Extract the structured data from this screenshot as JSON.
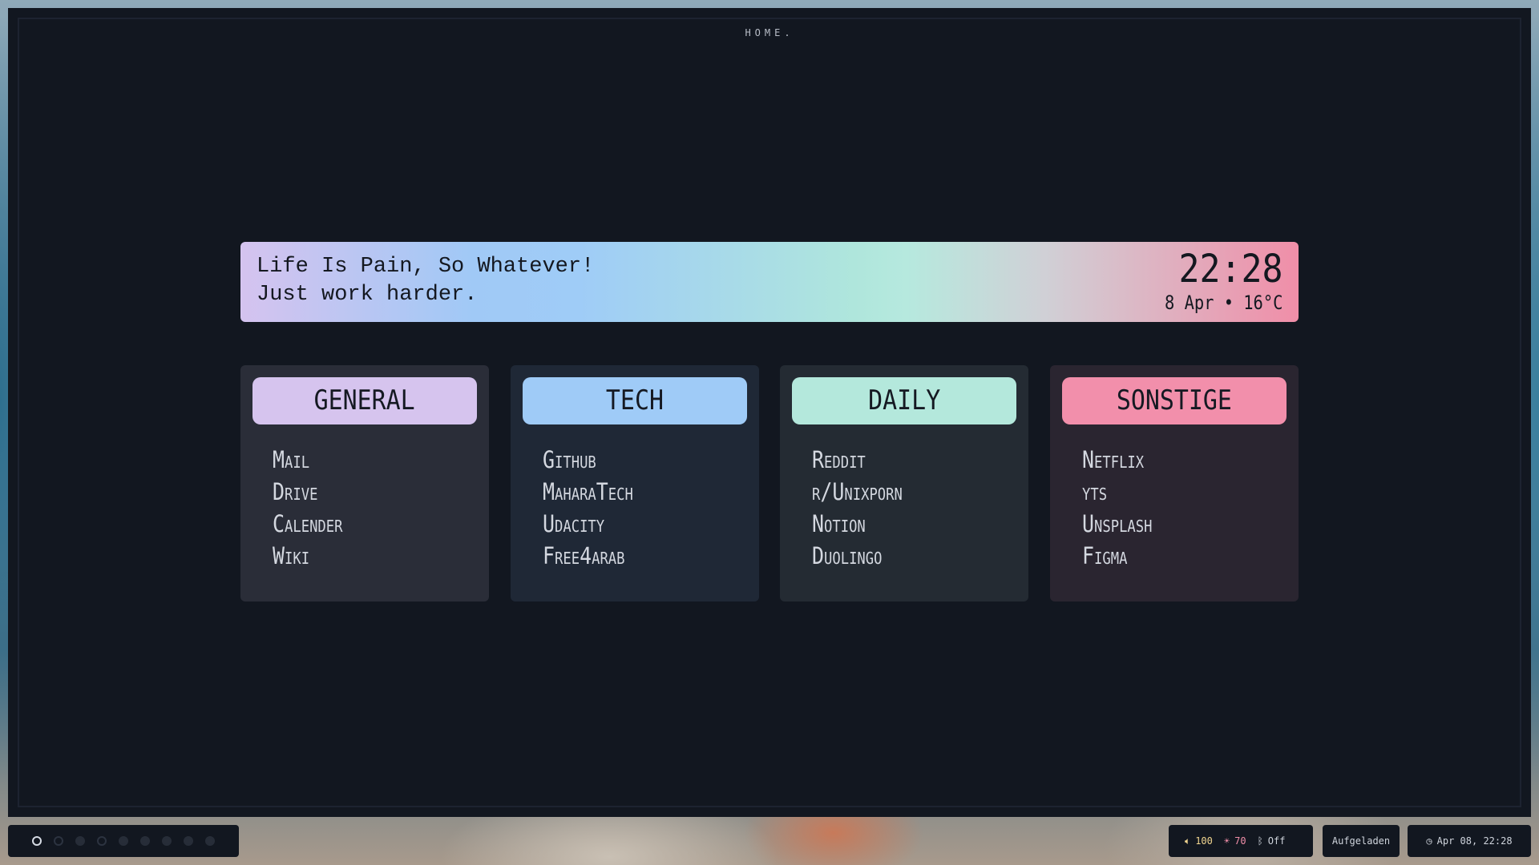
{
  "window": {
    "title": "HOME."
  },
  "banner": {
    "quote_line1": "Life Is Pain, So Whatever!",
    "quote_line2": "Just work harder.",
    "time": "22:28",
    "date": "8 Apr • 16°C"
  },
  "cards": [
    {
      "title": "GENERAL",
      "color": "#d6c4ee",
      "bg": "#2a2d38",
      "links": [
        "Mail",
        "Drive",
        "Calender",
        "Wiki"
      ]
    },
    {
      "title": "TECH",
      "color": "#9fcbf7",
      "bg": "#1f2836",
      "links": [
        "Github",
        "MaharaTech",
        "Udacity",
        "Free4arab"
      ]
    },
    {
      "title": "DAILY",
      "color": "#b4e8dc",
      "bg": "#242b33",
      "links": [
        "Reddit",
        "r/Unixporn",
        "Notion",
        "Duolingo"
      ]
    },
    {
      "title": "SONSTIGE",
      "color": "#f28fab",
      "bg": "#2a2530",
      "links": [
        "Netflix",
        "yts",
        "Unsplash",
        "Figma"
      ]
    }
  ],
  "taskbar": {
    "workspaces": [
      {
        "state": "active"
      },
      {
        "state": "empty"
      },
      {
        "state": "filled"
      },
      {
        "state": "empty"
      },
      {
        "state": "filled"
      },
      {
        "state": "filled"
      },
      {
        "state": "filled"
      },
      {
        "state": "filled"
      },
      {
        "state": "filled"
      }
    ],
    "volume": "100",
    "brightness": "70",
    "bluetooth": "Off",
    "battery": "Aufgeladen",
    "clock": "Apr 08, 22:28"
  },
  "icons": {
    "volume": "volume-icon",
    "brightness": "brightness-icon",
    "bluetooth": "bluetooth-icon",
    "clock": "clock-icon"
  }
}
